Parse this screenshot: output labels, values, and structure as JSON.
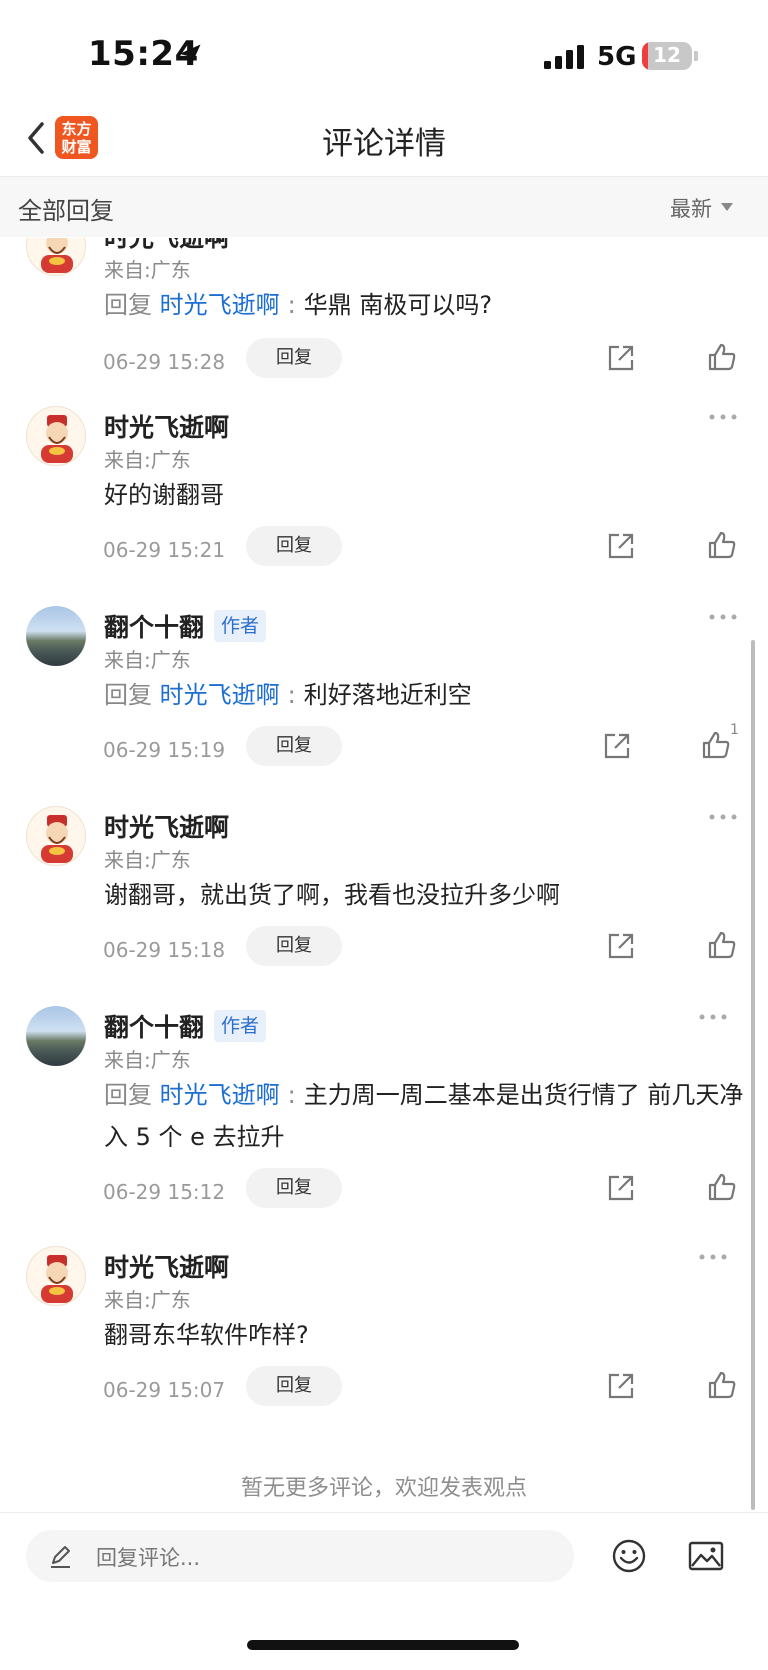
{
  "status": {
    "time": "15:24",
    "network": "5G",
    "battery": "12",
    "battery_level_percent": 12
  },
  "nav": {
    "logo": [
      "东方",
      "财富"
    ],
    "title": "评论详情"
  },
  "sort": {
    "label": "全部回复",
    "order": "最新"
  },
  "comments": [
    {
      "user": "时光飞逝啊",
      "author": false,
      "from": "来自:广东",
      "reply_word": "回复",
      "reply_to": "时光飞逝啊",
      "text": "华鼎 南极可以吗?",
      "date": "06-29 15:28",
      "reply_btn": "回复",
      "likes": ""
    },
    {
      "user": "时光飞逝啊",
      "author": false,
      "from": "来自:广东",
      "reply_word": "",
      "reply_to": "",
      "text": "好的谢翻哥",
      "date": "06-29 15:21",
      "reply_btn": "回复",
      "likes": ""
    },
    {
      "user": "翻个十翻",
      "author": true,
      "author_tag": "作者",
      "from": "来自:广东",
      "reply_word": "回复",
      "reply_to": "时光飞逝啊",
      "text": "利好落地近利空",
      "date": "06-29 15:19",
      "reply_btn": "回复",
      "likes": "1"
    },
    {
      "user": "时光飞逝啊",
      "author": false,
      "from": "来自:广东",
      "reply_word": "",
      "reply_to": "",
      "text": "谢翻哥，就出货了啊，我看也没拉升多少啊",
      "date": "06-29 15:18",
      "reply_btn": "回复",
      "likes": ""
    },
    {
      "user": "翻个十翻",
      "author": true,
      "author_tag": "作者",
      "from": "来自:广东",
      "reply_word": "回复",
      "reply_to": "时光飞逝啊",
      "text": "主力周一周二基本是出货行情了 前几天净入 5 个 e 去拉升",
      "date": "06-29 15:12",
      "reply_btn": "回复",
      "likes": ""
    },
    {
      "user": "时光飞逝啊",
      "author": false,
      "from": "来自:广东",
      "reply_word": "",
      "reply_to": "",
      "text": "翻哥东华软件咋样?",
      "date": "06-29 15:07",
      "reply_btn": "回复",
      "likes": ""
    }
  ],
  "footer_note": "暂无更多评论，欢迎发表观点",
  "bottom": {
    "input_placeholder": "回复评论..."
  },
  "icons": [
    "location-arrow-icon",
    "signal-icon",
    "back-icon",
    "caret-down-icon",
    "more-icon",
    "share-icon",
    "like-icon",
    "pen-icon",
    "emoji-icon",
    "image-icon"
  ]
}
